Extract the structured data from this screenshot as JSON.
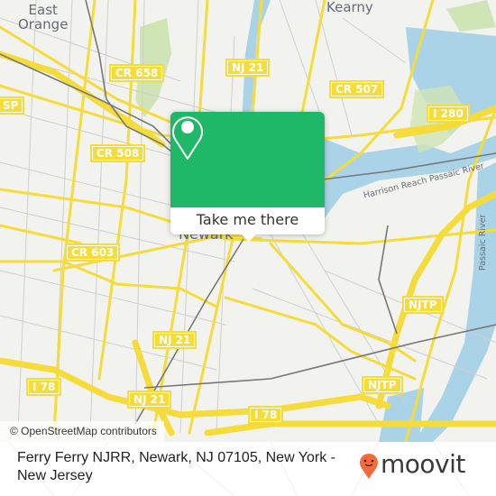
{
  "map": {
    "places": [
      {
        "name": "East Orange",
        "lines": [
          "East",
          "Orange"
        ]
      },
      {
        "name": "Kearny",
        "lines": [
          "Kearny"
        ]
      },
      {
        "name": "Newark",
        "lines": [
          "Newark"
        ]
      }
    ],
    "road_shields": [
      {
        "id": "cr658",
        "label": "CR 658"
      },
      {
        "id": "nj21-top",
        "label": "NJ 21"
      },
      {
        "id": "cr507",
        "label": "CR 507"
      },
      {
        "id": "i280",
        "label": "I 280"
      },
      {
        "id": "sp",
        "label": "SP"
      },
      {
        "id": "cr508",
        "label": "CR 508"
      },
      {
        "id": "cr603",
        "label": "CR 603"
      },
      {
        "id": "njtp-upper",
        "label": "NJTP"
      },
      {
        "id": "njtp-lower",
        "label": "NJTP"
      },
      {
        "id": "nj21-mid",
        "label": "NJ 21"
      },
      {
        "id": "nj21-low",
        "label": "NJ 21"
      },
      {
        "id": "i78-left",
        "label": "I 78"
      },
      {
        "id": "i78-right",
        "label": "I 78"
      }
    ],
    "water_labels": {
      "harrison_reach": "Harrison Reach Passaic River",
      "passaic_river": "Passaic River"
    },
    "attribution": "© OpenStreetMap contributors",
    "colors": {
      "land": "#f2f2ee",
      "water": "#aad3e8",
      "park": "#cfe5b5",
      "road_major": "#f5dc3a",
      "road_minor": "#c9c9c9",
      "rail": "#777777"
    }
  },
  "popup": {
    "icon": "map-pin-icon",
    "button_label": "Take me there",
    "accent": "#1fb868"
  },
  "footer": {
    "address": "Ferry Ferry NJRR, Newark, NJ 07105, New York - New Jersey",
    "brand": "moovit",
    "brand_color": "#f26b3a"
  }
}
